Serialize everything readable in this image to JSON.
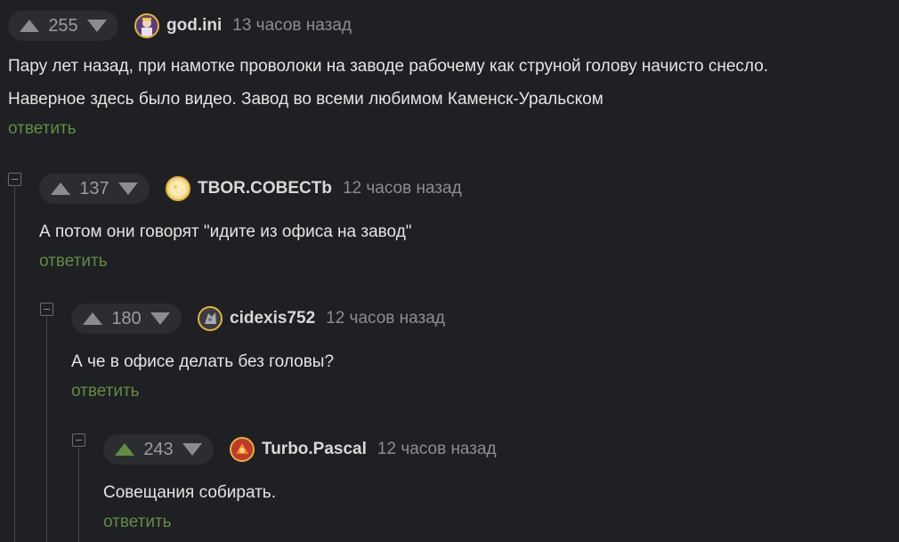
{
  "comments": [
    {
      "score": "255",
      "username": "god.ini",
      "time": "13 часов назад",
      "lines": [
        "Пару лет назад, при намотке проволоки на заводе рабочему как струной голову начисто снесло.",
        "Наверное здесь было видео. Завод во всеми любимом Каменск-Уральском"
      ],
      "reply": "ответить",
      "upvoted": false
    },
    {
      "score": "137",
      "username": "TBOR.COBECTb",
      "time": "12 часов назад",
      "lines": [
        "А потом они говорят \"идите из офиса на завод\""
      ],
      "reply": "ответить",
      "upvoted": false
    },
    {
      "score": "180",
      "username": "cidexis752",
      "time": "12 часов назад",
      "lines": [
        "А че в офисе делать без головы?"
      ],
      "reply": "ответить",
      "upvoted": false
    },
    {
      "score": "243",
      "username": "Turbo.Pascal",
      "time": "12 часов назад",
      "lines": [
        "Совещания собирать."
      ],
      "reply": "ответить",
      "upvoted": true
    }
  ],
  "colors": {
    "background": "#1f2023",
    "vote_pill": "#2c2d31",
    "reply_link": "#5f8d42",
    "upvote_active": "#5f8d42",
    "arrow_inactive": "#8a8c91",
    "avatar_border": "#e2b23a"
  },
  "icons": {
    "upvote": "triangle-up-icon",
    "downvote": "triangle-down-icon",
    "collapse": "minus-square-icon"
  }
}
